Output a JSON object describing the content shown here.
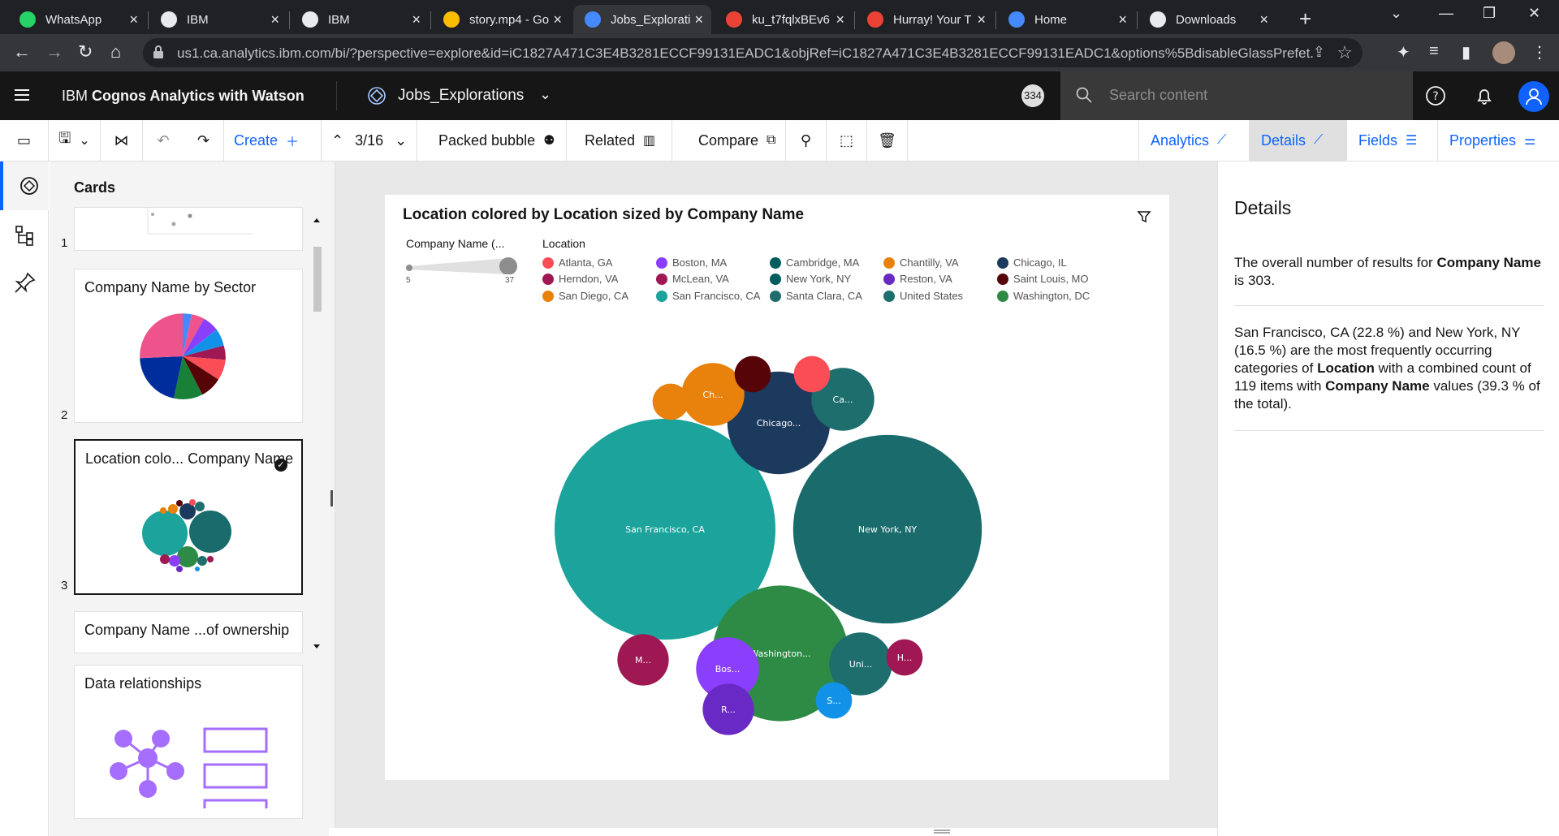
{
  "browser": {
    "tabs": [
      {
        "title": "WhatsApp",
        "icon": "whatsapp-icon",
        "color": "#25d366"
      },
      {
        "title": "IBM",
        "icon": "globe-icon",
        "color": "#e8eaed"
      },
      {
        "title": "IBM",
        "icon": "globe-icon",
        "color": "#e8eaed"
      },
      {
        "title": "story.mp4 - Go",
        "icon": "drive-icon",
        "color": "#fbbc04"
      },
      {
        "title": "Jobs_Explorati",
        "icon": "cognos-icon",
        "color": "#4589ff"
      },
      {
        "title": "ku_t7fqlxBEv6",
        "icon": "photos-icon",
        "color": "#ea4335"
      },
      {
        "title": "Hurray! Your T",
        "icon": "gmail-icon",
        "color": "#ea4335"
      },
      {
        "title": "Home",
        "icon": "cognos-icon",
        "color": "#4589ff"
      },
      {
        "title": "Downloads",
        "icon": "download-icon",
        "color": "#e8eaed"
      }
    ],
    "url": "us1.ca.analytics.ibm.com/bi/?perspective=explore&id=iC1827A471C3E4B3281ECCF99131EADC1&objRef=iC1827A471C3E4B3281ECCF99131EADC1&options%5BdisableGlassPrefet..."
  },
  "header": {
    "brand_prefix": "IBM",
    "brand_name": "Cognos Analytics with Watson",
    "exploration_name": "Jobs_Explorations",
    "count_badge": "334",
    "search_placeholder": "Search content"
  },
  "toolbar": {
    "create_label": "Create",
    "page_indicator": "3/16",
    "viz_type_label": "Packed bubble",
    "related_label": "Related",
    "compare_label": "Compare",
    "analytics_label": "Analytics",
    "details_label": "Details",
    "fields_label": "Fields",
    "properties_label": "Properties"
  },
  "cards": {
    "title": "Cards",
    "items": [
      {
        "number": "1",
        "title": ""
      },
      {
        "number": "2",
        "title": "Company Name by Sector"
      },
      {
        "number": "3",
        "title": "Location colo... Company Name"
      },
      {
        "number": "",
        "title": "Company Name ...of ownership"
      },
      {
        "number": "",
        "title": "Data relationships"
      }
    ]
  },
  "viz": {
    "title": "Location colored by Location sized by Company Name",
    "size_legend_title": "Company Name (...",
    "size_min": "5",
    "size_max": "37",
    "color_legend_title": "Location"
  },
  "chart_data": {
    "type": "packed-bubble",
    "title": "Location colored by Location sized by Company Name",
    "size_range": [
      5,
      37
    ],
    "legend": [
      {
        "name": "Atlanta, GA",
        "color": "#fa4d56"
      },
      {
        "name": "Boston, MA",
        "color": "#8a3ffc"
      },
      {
        "name": "Cambridge, MA",
        "color": "#005d5d"
      },
      {
        "name": "Chantilly, VA",
        "color": "#e8820c"
      },
      {
        "name": "Chicago, IL",
        "color": "#1c3a5e"
      },
      {
        "name": "Herndon, VA",
        "color": "#9f1853"
      },
      {
        "name": "McLean, VA",
        "color": "#9f1853"
      },
      {
        "name": "New York, NY",
        "color": "#005d5d"
      },
      {
        "name": "Reston, VA",
        "color": "#6929c4"
      },
      {
        "name": "Saint Louis, MO",
        "color": "#570408"
      },
      {
        "name": "San Diego, CA",
        "color": "#e8820c"
      },
      {
        "name": "San Francisco, CA",
        "color": "#1ba39c"
      },
      {
        "name": "Santa Clara, CA",
        "color": "#1e6e6e"
      },
      {
        "name": "United States",
        "color": "#1e6e6e"
      },
      {
        "name": "Washington, DC",
        "color": "#2e8b46"
      }
    ],
    "bubbles": [
      {
        "label": "San Francisco, CA",
        "value": 37,
        "color": "#1ba39c"
      },
      {
        "label": "New York, NY",
        "value": 27,
        "color": "#1a6b6b"
      },
      {
        "label": "Washington...",
        "value": 14,
        "color": "#2e8b46"
      },
      {
        "label": "Chicago...",
        "value": 8,
        "color": "#1c3a5e"
      },
      {
        "label": "Ch...",
        "value": 3,
        "color": "#e8820c"
      },
      {
        "label": "Ca...",
        "value": 3,
        "color": "#1e6e6e"
      },
      {
        "label": "Uni...",
        "value": 3,
        "color": "#1e6e6e"
      },
      {
        "label": "Bos...",
        "value": 3,
        "color": "#8a3ffc"
      },
      {
        "label": "M...",
        "value": 2,
        "color": "#9f1853"
      },
      {
        "label": "R...",
        "value": 2,
        "color": "#6929c4"
      },
      {
        "label": "H...",
        "value": 1,
        "color": "#9f1853"
      },
      {
        "label": "S...",
        "value": 1,
        "color": "#1192e8"
      },
      {
        "label": "",
        "value": 1,
        "color": "#e8820c"
      },
      {
        "label": "",
        "value": 1,
        "color": "#570408"
      },
      {
        "label": "",
        "value": 1,
        "color": "#fa4d56"
      }
    ]
  },
  "details": {
    "title": "Details",
    "para1_a": "The overall number of results for ",
    "para1_b": "Company Name",
    "para1_c": " is 303.",
    "para2_a": "San Francisco, CA (22.8 %) and New York, NY (16.5 %) are the most frequently occurring categories of ",
    "para2_b": "Location",
    "para2_c": " with a combined count of 119 items with ",
    "para2_d": "Company Name",
    "para2_e": " values (39.3 % of the total)."
  }
}
